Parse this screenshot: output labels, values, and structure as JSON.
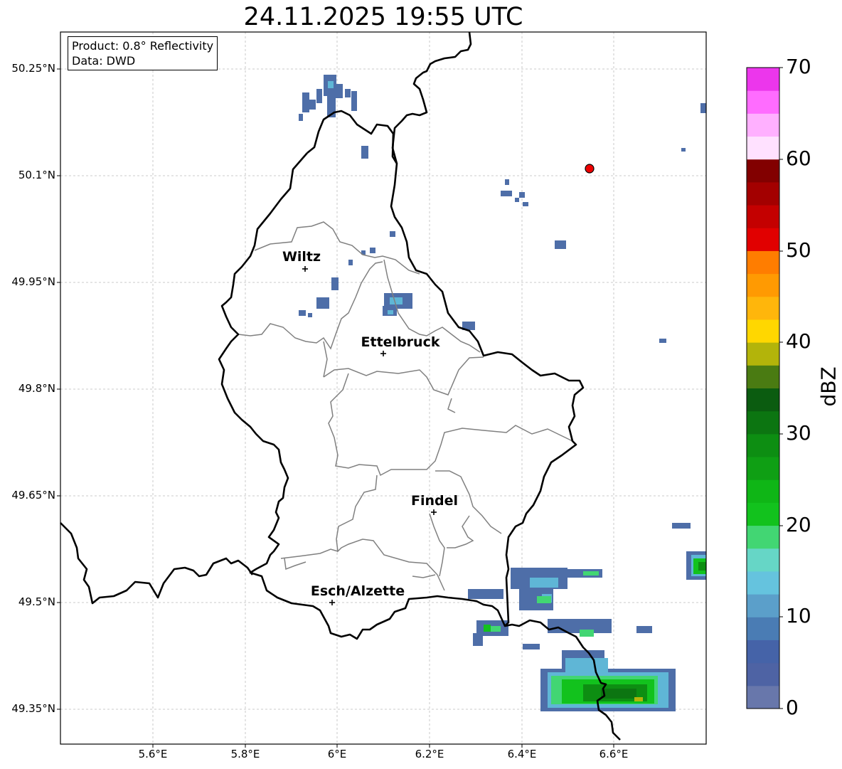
{
  "title": "24.11.2025 19:55 UTC",
  "info": {
    "product": "Product: 0.8° Reflectivity",
    "source": "Data: DWD"
  },
  "lat_labels": [
    "50.25°N",
    "50.1°N",
    "49.95°N",
    "49.8°N",
    "49.65°N",
    "49.5°N",
    "49.35°N"
  ],
  "lon_labels": [
    "5.6°E",
    "5.8°E",
    "6°E",
    "6.2°E",
    "6.4°E",
    "6.6°E"
  ],
  "cities": [
    {
      "name": "Wiltz"
    },
    {
      "name": "Ettelbruck"
    },
    {
      "name": "Findel"
    },
    {
      "name": "Esch/Alzette"
    }
  ],
  "colorbar": {
    "label": "dBZ",
    "ticks": [
      "0",
      "10",
      "20",
      "30",
      "40",
      "50",
      "60",
      "70"
    ],
    "colors": [
      "#6877ab",
      "#4e63a4",
      "#4563a8",
      "#4a7cb4",
      "#5b9fca",
      "#65c3de",
      "#66d6c6",
      "#42d673",
      "#12c21d",
      "#0fb616",
      "#0f9f14",
      "#0d8e12",
      "#0c7511",
      "#0b5c10",
      "#4a7b12",
      "#b3b40a",
      "#ffd700",
      "#ffb60b",
      "#ff9a02",
      "#ff7d00",
      "#e10000",
      "#c40000",
      "#a30000",
      "#820000",
      "#ffe1ff",
      "#ffb0ff",
      "#ff6cff",
      "#ec36ec"
    ]
  },
  "colors": {
    "border": "#000000",
    "canton": "#808080",
    "grid": "#bbbbbb",
    "marker": "#ee0000"
  }
}
